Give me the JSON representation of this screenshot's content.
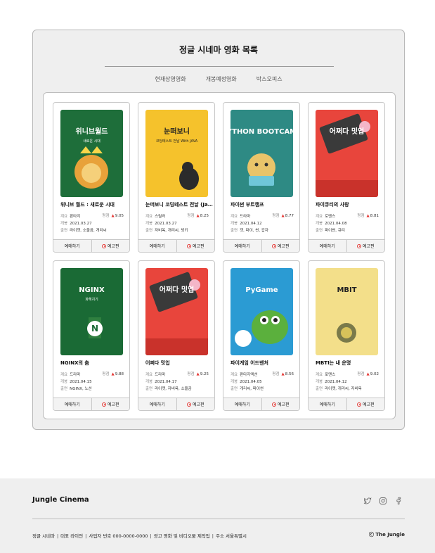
{
  "page": {
    "title": "정글 시네마 영화 목록",
    "tabs": [
      "현재상영영화",
      "개봉예정영화",
      "박스오피스"
    ]
  },
  "labels": {
    "genre": "계요",
    "release": "개봉",
    "cast": "출연",
    "rating": "평점",
    "booking_button": "예매하기",
    "trailer_button": "예고편"
  },
  "movies": [
    {
      "title": "위니브 월드 : 새로운 시대",
      "genre": "판타지",
      "rating": "9.05",
      "release": "2021.03.27",
      "cast": "라이캣, 소울곰, 개리씨",
      "poster_text": "위니브월드",
      "poster_sub": "새로운 시대",
      "poster_bg": "#1e6e3a"
    },
    {
      "title": "눈떠보니 코딩테스트 전날 (Java)",
      "genre": "스릴러",
      "rating": "8.25",
      "release": "2021.03.27",
      "cast": "자비옥, 개리씨, 빙키",
      "poster_text": "눈떠보니",
      "poster_sub": "코딩테스트 전날 With JAVA",
      "poster_bg": "#f5c22c"
    },
    {
      "title": "파이썬 부트캠프",
      "genre": "드라마",
      "rating": "8.77",
      "release": "2021.04.12",
      "cast": "캣, 파이, 썬, 갑자",
      "poster_text": "PYTHON BOOTCAMP",
      "poster_sub": "",
      "poster_bg": "#2e8a84"
    },
    {
      "title": "파이큐티의 사랑",
      "genre": "로맨스",
      "rating": "8.81",
      "release": "2021.04.08",
      "cast": "파이썬, 큐티",
      "poster_text": "어쩌다 밋업",
      "poster_sub": "",
      "poster_bg": "#e8453c"
    },
    {
      "title": "NGINX의 춤",
      "genre": "드라마",
      "rating": "9.88",
      "release": "2021.04.15",
      "cast": "NGINX, 노션",
      "poster_text": "NGINX",
      "poster_sub": "파헤치기",
      "poster_bg": "#1a6a35"
    },
    {
      "title": "어쩌다 밋업",
      "genre": "드라마",
      "rating": "9.25",
      "release": "2021.04.17",
      "cast": "라이캣, 자비옥, 소울곰",
      "poster_text": "어쩌다 밋업",
      "poster_sub": "",
      "poster_bg": "#e8453c"
    },
    {
      "title": "파이게임 어드밴처",
      "genre": "판타지액션",
      "rating": "8.56",
      "release": "2021.04.05",
      "cast": "개리씨, 파이썬",
      "poster_text": "PyGame",
      "poster_sub": "",
      "poster_bg": "#2b9bd3"
    },
    {
      "title": "MBTI는 내 운명",
      "genre": "로맨스",
      "rating": "9.02",
      "release": "2021.04.12",
      "cast": "라이캣, 개리씨, 자비옥",
      "poster_text": "MBIT",
      "poster_sub": "",
      "poster_bg": "#f3df8a"
    }
  ],
  "footer": {
    "brand": "Jungle Cinema",
    "info": [
      "정글 시네마",
      "대표 라이언",
      "사업자 번호 000-0000-0000",
      "광고 영화 및 비디오물 제작업",
      "주소 서울특별시"
    ],
    "copyright": "ⓒ The Jungle",
    "social_icons": [
      "twitter-icon",
      "instagram-icon",
      "facebook-icon"
    ]
  }
}
